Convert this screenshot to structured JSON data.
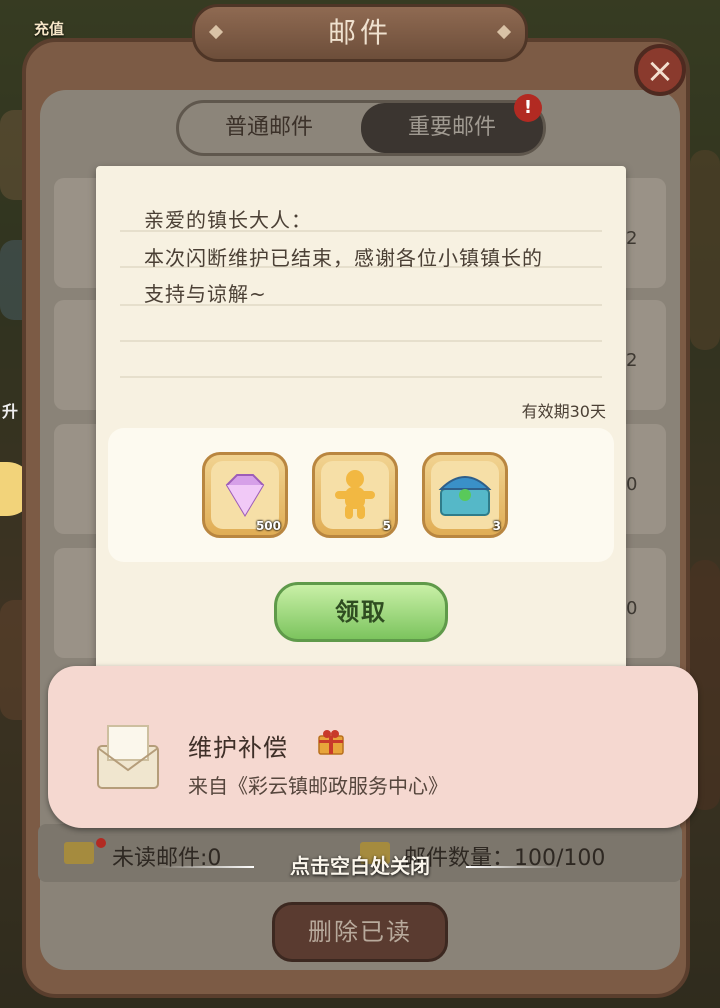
{
  "top": {
    "recharge_label": "充值"
  },
  "window": {
    "title": "邮件"
  },
  "tabs": {
    "normal": "普通邮件",
    "important": "重要邮件",
    "badge": "!"
  },
  "list_numbers": [
    "2",
    "2",
    "0",
    "0"
  ],
  "side_labels": {
    "upgrade": "升"
  },
  "letter": {
    "greeting": "亲爱的镇长大人：",
    "line1": "本次闪断维护已结束，感谢各位小镇镇长的",
    "line2": "支持与谅解~",
    "validity": "有效期30天"
  },
  "rewards": [
    {
      "icon": "diamond-icon",
      "count": "500"
    },
    {
      "icon": "gingerbread-icon",
      "count": "5"
    },
    {
      "icon": "treasure-chest-icon",
      "count": "3"
    }
  ],
  "claim_label": "领取",
  "mail": {
    "title": "维护补偿",
    "sender": "来自《彩云镇邮政服务中心》"
  },
  "status": {
    "unread": "未读邮件:0",
    "count": "邮件数量：100/100"
  },
  "hint": "点击空白处关闭",
  "delete_label": "删除已读",
  "colors": {
    "claim_green": "#7cc45e",
    "pocket_pink": "#f5d8d0",
    "badge_red": "#b22a22"
  }
}
